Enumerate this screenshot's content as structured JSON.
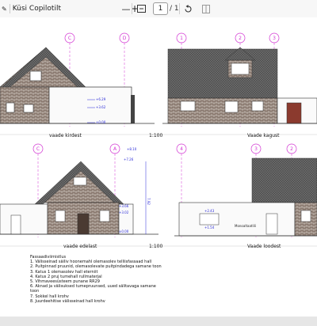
{
  "toolbar": {
    "copilot_label": "Küsi Copilotilt",
    "current_page": "1",
    "page_total": "/ 1",
    "zoom_out": "—",
    "zoom_in": "+"
  },
  "drawing": {
    "top_axes": [
      "C",
      "D",
      "1",
      "2",
      "3"
    ],
    "bottom_axes": [
      "C",
      "A",
      "4",
      "3",
      "2"
    ],
    "captions": {
      "north": "vaade kirdest",
      "scale_top": "1:100",
      "back": "Vaade kagust",
      "front": "vaade edelast",
      "scale_bottom": "1:100",
      "south": "Vaade loodest"
    },
    "level_marks": {
      "l1": "+6.29",
      "l2": "+3.62",
      "l3": "±0.00",
      "l4": "+8.10",
      "l5": "+7.26",
      "l6": "+3.66",
      "l7": "+3.02",
      "l8": "±0.00",
      "l9": "+1.54",
      "l10": "+2.43",
      "dim_total": "7.92"
    },
    "label_material": "Monoaltaatlili"
  },
  "notes": {
    "title": "Fassaadiviimistlus",
    "items": [
      "1. Välisseinad säiliv hoonemahl olemasolev telliisfassaad hall",
      "2. Puitpinnad pruunid, olemasolevate puitpindadega samane toon",
      "3. Katus 1 olemasolev hall eterniit",
      "4. Katus 2 pruj tumehall rullmaterjal",
      "5. Vihmaveesüsteem punane RR29",
      "6. Aknad ja välisuksed tumepruunsed, uued sälitavaga samane",
      "toon",
      "7. Sokkel hall krohv",
      "8. Juurdeehitise välisseinad hall krohv"
    ]
  },
  "colors": {
    "axis_magenta": "#d233d2",
    "dim_blue": "#2a2ad8",
    "brick": "#7b6a61",
    "roof": "#5a5a5a"
  }
}
